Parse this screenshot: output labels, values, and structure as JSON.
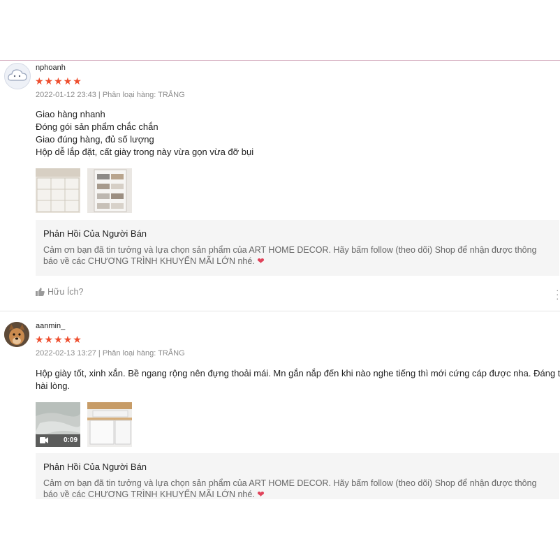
{
  "reviews": [
    {
      "username": "nphoanh",
      "stars": "★★★★★",
      "rating": 5,
      "meta": "2022-01-12 23:43 | Phân loại hàng: TRẮNG",
      "body_lines": [
        "Giao hàng nhanh",
        "Đóng gói sản phẩm chắc chắn",
        "Giao đúng hàng, đủ số lượng",
        "Hộp dễ lắp đặt, cất giày trong này vừa gọn vừa đỡ bụi"
      ],
      "reply_title": "Phản Hồi Của Người Bán",
      "reply_text": "Cảm ơn bạn đã tin tưởng và lựa chọn sản phẩm của ART HOME DECOR. Hãy bấm follow (theo dõi) Shop để nhận được thông báo về các CHƯƠNG TRÌNH KHUYẾN MÃI LỚN nhé.",
      "reply_heart": "❤",
      "helpful_label": "Hữu Ích?"
    },
    {
      "username": "aanmin_",
      "stars": "★★★★★",
      "rating": 5,
      "meta": "2022-02-13 13:27 | Phân loại hàng: TRẮNG",
      "body_lines": [
        "Hộp giày tốt, xinh xắn. Bề ngang rộng nên đựng thoải mái. Mn gắn nắp đến khi nào nghe tiếng thì mới cứng cáp được nha. Đáng tiền,",
        "hài lòng."
      ],
      "video_duration": "0:09",
      "reply_title": "Phản Hồi Của Người Bán",
      "reply_text": "Cảm ơn bạn đã tin tưởng và lựa chọn sản phẩm của ART HOME DECOR. Hãy bấm follow (theo dõi) Shop để nhận được thông báo về các CHƯƠNG TRÌNH KHUYẾN MÃI LỚN nhé.",
      "reply_heart": "❤"
    }
  ],
  "colors": {
    "star": "#ee4d2d",
    "heart": "#e0435a",
    "reply_bg": "#f5f5f5"
  }
}
